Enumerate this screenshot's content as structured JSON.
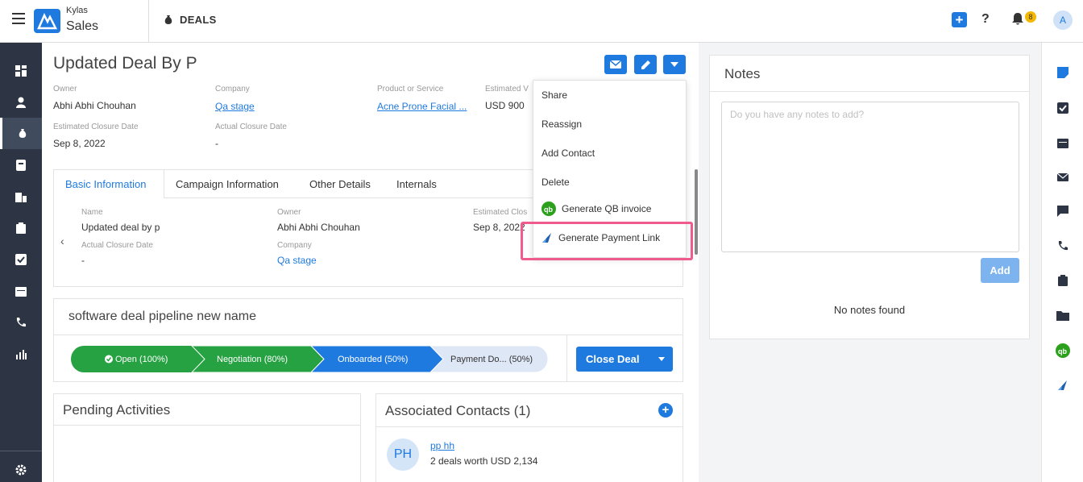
{
  "app": {
    "brand_small": "Kylas",
    "brand_big": "Sales",
    "module": "DEALS"
  },
  "topbar": {
    "notifications_count": "8",
    "avatar_initial": "A"
  },
  "deal": {
    "title": "Updated Deal By P",
    "fields": {
      "owner_label": "Owner",
      "owner": "Abhi Abhi Chouhan",
      "company_label": "Company",
      "company": "Qa stage",
      "product_label": "Product or Service",
      "product": "Acne Prone Facial ...",
      "est_value_label": "Estimated V",
      "est_value": "USD 900",
      "est_close_label": "Estimated Closure Date",
      "est_close": "Sep 8, 2022",
      "actual_close_label": "Actual Closure Date",
      "actual_close": "-"
    }
  },
  "tabs": [
    "Basic Information",
    "Campaign Information",
    "Other Details",
    "Internals"
  ],
  "basic_info": {
    "name_label": "Name",
    "name": "Updated deal by p",
    "owner_label": "Owner",
    "owner": "Abhi Abhi Chouhan",
    "est_close_label": "Estimated Clos",
    "est_close": "Sep 8, 2022",
    "actual_close_label": "Actual Closure Date",
    "actual_close": "-",
    "company_label": "Company",
    "company": "Qa stage"
  },
  "pipeline": {
    "title": "software deal pipeline new name",
    "stages": [
      {
        "label": "Open (100%)",
        "color": "#27a243"
      },
      {
        "label": "Negotiation (80%)",
        "color": "#27a243"
      },
      {
        "label": "Onboarded (50%)",
        "color": "#1f7ae0"
      },
      {
        "label": "Payment Do... (50%)",
        "color": "#dde7f6"
      }
    ],
    "close_label": "Close Deal"
  },
  "pending": {
    "title": "Pending Activities"
  },
  "contacts": {
    "title": "Associated Contacts (1)",
    "items": [
      {
        "initials": "PH",
        "name": "pp hh",
        "detail": "2 deals worth USD 2,134"
      }
    ]
  },
  "menu": {
    "items": [
      "Share",
      "Reassign",
      "Add Contact",
      "Delete",
      "Generate QB invoice",
      "Generate Payment Link"
    ]
  },
  "notes": {
    "title": "Notes",
    "placeholder": "Do you have any notes to add?",
    "add_label": "Add",
    "empty_text": "No notes found"
  },
  "colors": {
    "accent": "#1f7ae0",
    "sidebar": "#2d3545",
    "highlight": "#ef5b8d"
  }
}
